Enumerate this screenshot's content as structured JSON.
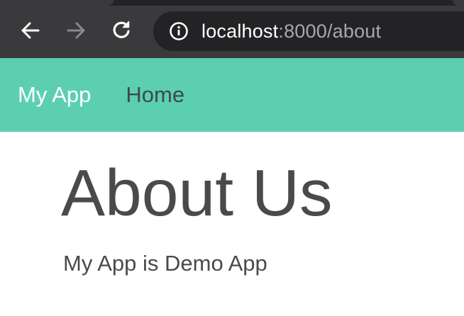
{
  "browser": {
    "url_host": "localhost",
    "url_path": ":8000/about",
    "icons": {
      "back": "arrow-left-icon",
      "forward": "arrow-right-icon",
      "reload": "reload-icon",
      "info": "info-icon"
    },
    "colors": {
      "chrome_bg": "#3a3a3d",
      "address_bg": "#232326",
      "url_path": "#a8a8ab"
    }
  },
  "navbar": {
    "brand": "My App",
    "links": [
      {
        "label": "Home"
      }
    ],
    "colors": {
      "background": "#5dcfb1",
      "brand": "#ffffff",
      "link": "#3c4a48"
    }
  },
  "main": {
    "title": "About Us",
    "body": "My App is Demo App"
  }
}
